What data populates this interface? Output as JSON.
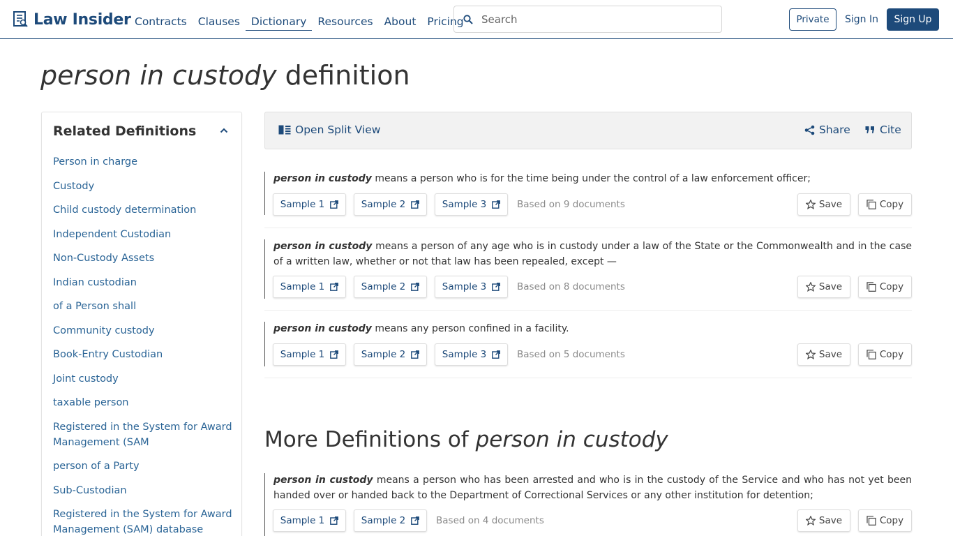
{
  "header": {
    "logo_text": "Law Insider",
    "nav": [
      {
        "label": "Contracts"
      },
      {
        "label": "Clauses"
      },
      {
        "label": "Dictionary"
      },
      {
        "label": "Resources"
      },
      {
        "label": "About"
      },
      {
        "label": "Pricing"
      }
    ],
    "search_placeholder": "Search",
    "private_label": "Private",
    "signin_label": "Sign In",
    "signup_label": "Sign Up"
  },
  "page": {
    "term": "person in custody",
    "title_suffix": " definition"
  },
  "sidebar": {
    "title": "Related Definitions",
    "items": [
      "Person in charge",
      "Custody",
      "Child custody determination",
      "Independent Custodian",
      "Non-Custody Assets",
      "Indian custodian",
      "of a Person shall",
      "Community custody",
      "Book-Entry Custodian",
      "Joint custody",
      "taxable person",
      "Registered in the System for Award Management (SAM",
      "person of a Party",
      "Sub-Custodian",
      "Registered in the System for Award Management (SAM) database"
    ]
  },
  "toolbar": {
    "split_label": "Open Split View",
    "share_label": "Share",
    "cite_label": "Cite"
  },
  "definitions": [
    {
      "term": "person in custody",
      "text": " means a person who is for the time being under the control of a law enforcement officer;",
      "samples": [
        "Sample 1",
        "Sample 2",
        "Sample 3"
      ],
      "based_on": "Based on 9 documents"
    },
    {
      "term": "person in custody",
      "text": " means a person of any age who is in custody under a law of the State or the Commonwealth and in the case of a written law, whether or not that law has been repealed, except —",
      "samples": [
        "Sample 1",
        "Sample 2",
        "Sample 3"
      ],
      "based_on": "Based on 8 documents"
    },
    {
      "term": "person in custody",
      "text": " means any person confined in a facility.",
      "samples": [
        "Sample 1",
        "Sample 2",
        "Sample 3"
      ],
      "based_on": "Based on 5 documents"
    }
  ],
  "more": {
    "title_prefix": "More Definitions of ",
    "term": "person in custody",
    "definitions": [
      {
        "term": "person in custody",
        "text": " means a person who has been arrested and who is in the custody of the Service and who has not yet been handed over or handed back to the Department of Correctional Services or any other institution for detention;",
        "samples": [
          "Sample 1",
          "Sample 2"
        ],
        "based_on": "Based on 4 documents"
      }
    ]
  },
  "actions": {
    "save_label": "Save",
    "copy_label": "Copy"
  },
  "colors": {
    "brand": "#1d4a7a",
    "link": "#2a6496",
    "muted": "#8a8a8a"
  }
}
